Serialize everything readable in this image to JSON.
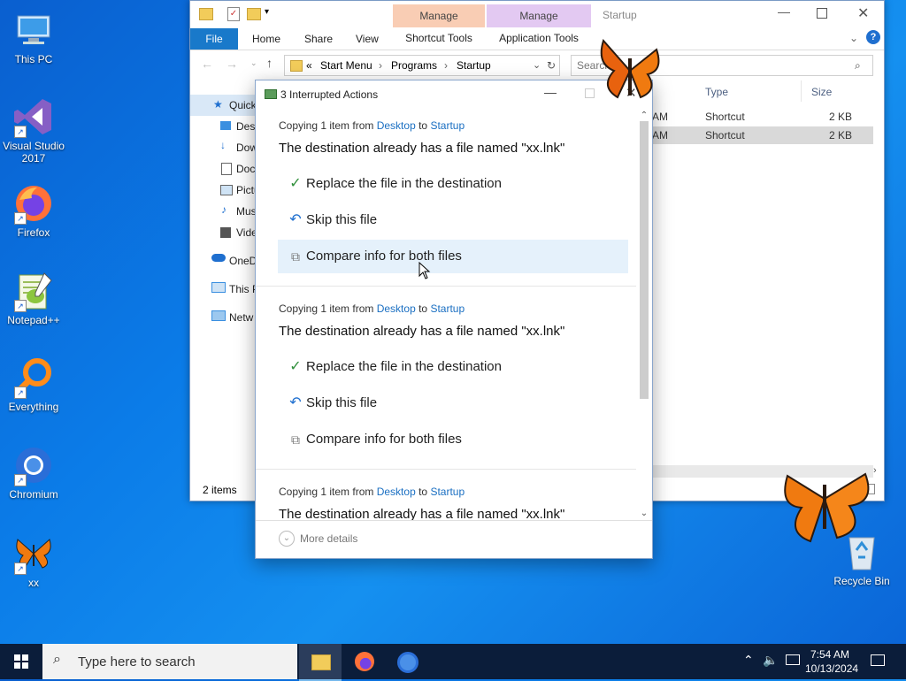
{
  "desktop": {
    "icons": [
      {
        "label": "This PC"
      },
      {
        "label": "Visual Studio\n2017"
      },
      {
        "label": "Firefox"
      },
      {
        "label": "Notepad++"
      },
      {
        "label": "Everything"
      },
      {
        "label": "Chromium"
      },
      {
        "label": "xx"
      },
      {
        "label": "Recycle Bin"
      }
    ]
  },
  "explorer": {
    "title": "Startup",
    "manage1": {
      "top": "Manage",
      "bottom": "Shortcut Tools"
    },
    "manage2": {
      "top": "Manage",
      "bottom": "Application Tools"
    },
    "tabs": [
      "File",
      "Home",
      "Share",
      "View"
    ],
    "address": {
      "prefix": "«",
      "crumbs": [
        "Start Menu",
        "Programs",
        "Startup"
      ]
    },
    "search_placeholder": "Search",
    "nav": [
      "Quick",
      "Desk",
      "Dow",
      "Doc",
      "Pictu",
      "Mus",
      "Vide",
      "OneD",
      "This P",
      "Netw"
    ],
    "columns": {
      "type": "Type",
      "size": "Size"
    },
    "rows": [
      {
        "time": "AM",
        "type": "Shortcut",
        "size": "2 KB"
      },
      {
        "time": "AM",
        "type": "Shortcut",
        "size": "2 KB"
      }
    ],
    "status": "2 items"
  },
  "dialog": {
    "title": "3 Interrupted Actions",
    "blocks": [
      {
        "copy_prefix": "Copying 1 item from",
        "from": "Desktop",
        "to_word": "to",
        "to": "Startup",
        "dest": "The destination already has a file named \"xx.lnk\"",
        "opt_replace": "Replace the file in the destination",
        "opt_skip": "Skip this file",
        "opt_compare": "Compare info for both files"
      },
      {
        "copy_prefix": "Copying 1 item from",
        "from": "Desktop",
        "to_word": "to",
        "to": "Startup",
        "dest": "The destination already has a file named \"xx.lnk\"",
        "opt_replace": "Replace the file in the destination",
        "opt_skip": "Skip this file",
        "opt_compare": "Compare info for both files"
      },
      {
        "copy_prefix": "Copying 1 item from",
        "from": "Desktop",
        "to_word": "to",
        "to": "Startup",
        "dest": "The destination already has a file named \"xx.lnk\""
      }
    ],
    "more_details": "More details"
  },
  "taskbar": {
    "search_placeholder": "Type here to search",
    "time": "7:54 AM",
    "date": "10/13/2024"
  },
  "colors": {
    "file_tab": "#1979ca",
    "manage_shortcut": "#f9cdb4",
    "manage_app": "#e3c9f2",
    "hover": "#e5f1fb",
    "link": "#1a6fc2"
  }
}
